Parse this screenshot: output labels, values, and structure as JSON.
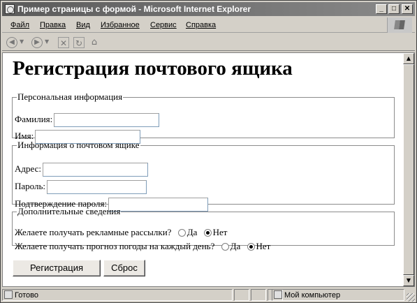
{
  "window": {
    "title": "Пример страницы с формой - Microsoft Internet Explorer",
    "controls": {
      "minimize": "_",
      "maximize": "□",
      "close": "✕"
    }
  },
  "menu": [
    "Файл",
    "Правка",
    "Вид",
    "Избранное",
    "Сервис",
    "Справка"
  ],
  "toolbar": {
    "icons": [
      "back-icon",
      "forward-icon",
      "stop-icon",
      "refresh-icon",
      "home-icon"
    ]
  },
  "page": {
    "heading": "Регистрация почтового ящика",
    "personal": {
      "legend": "Персональная информация",
      "surname_label": "Фамилия:",
      "surname_value": "",
      "name_label": "Имя:",
      "name_value": ""
    },
    "mailbox": {
      "legend": "Информация о почтовом ящике",
      "address_label": "Адрес:",
      "address_value": "",
      "password_label": "Пароль:",
      "password_value": "",
      "confirm_label": "Подтверждение пароля:",
      "confirm_value": ""
    },
    "extra": {
      "legend": "Дополнительные сведения",
      "ads_question": "Желаете получать рекламные рассылки?",
      "weather_question": "Желаете получать прогноз погоды на каждый день?",
      "yes": "Да",
      "no": "Нет",
      "ads_selected": "Нет",
      "weather_selected": "Нет"
    },
    "buttons": {
      "submit": "Регистрация",
      "reset": "Сброс"
    }
  },
  "status": {
    "text": "Готово",
    "zone": "Мой компьютер"
  }
}
